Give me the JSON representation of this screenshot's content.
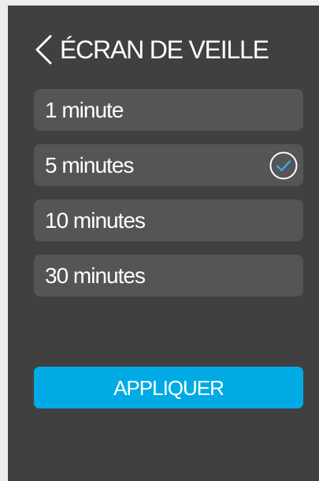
{
  "header": {
    "title": "ÉCRAN DE VEILLE",
    "back_icon": "chevron-left-icon"
  },
  "options": [
    {
      "label": "1 minute",
      "selected": false
    },
    {
      "label": "5 minutes",
      "selected": true
    },
    {
      "label": "10 minutes",
      "selected": false
    },
    {
      "label": "30 minutes",
      "selected": false
    }
  ],
  "selected_icon": "check-circle-icon",
  "apply_button": {
    "label": "APPLIQUER"
  },
  "colors": {
    "page_background": "#ededed",
    "panel_background": "#404041",
    "option_background": "#555557",
    "accent": "#00abe5",
    "text": "#ffffff"
  }
}
